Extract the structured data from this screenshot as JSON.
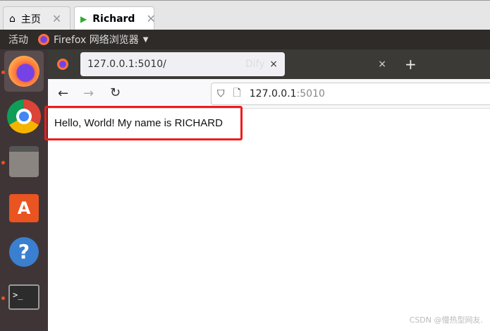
{
  "vm_tabs": [
    {
      "label": "主页",
      "icon": "home-icon"
    },
    {
      "label": "Richard",
      "icon": "vm-icon",
      "active": true
    }
  ],
  "topbar": {
    "activities": "活动",
    "app_menu": "Firefox 网络浏览器"
  },
  "dock": [
    "firefox",
    "chrome",
    "files",
    "software",
    "help",
    "terminal"
  ],
  "browser": {
    "tabs": [
      {
        "label": "127.0.0.1:5010/",
        "active": true
      },
      {
        "label": "Dify"
      }
    ],
    "new_tab": "+",
    "close": "×",
    "url_host": "127.0.0.1",
    "url_port": ":5010"
  },
  "page": {
    "text": "Hello, World! My name is RICHARD"
  },
  "watermark": "CSDN @慢热型网友."
}
